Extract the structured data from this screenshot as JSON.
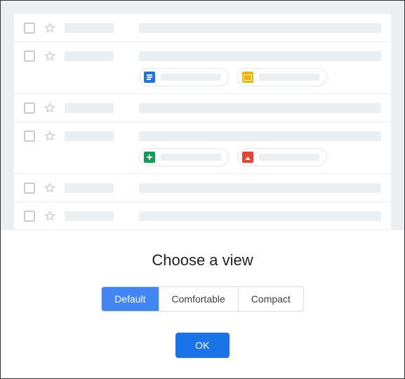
{
  "heading": "Choose a view",
  "options": {
    "default": "Default",
    "comfortable": "Comfortable",
    "compact": "Compact"
  },
  "selected_option": "default",
  "ok_label": "OK",
  "rows": [
    {
      "attachments": []
    },
    {
      "attachments": [
        {
          "type": "doc"
        },
        {
          "type": "slides"
        }
      ]
    },
    {
      "attachments": []
    },
    {
      "attachments": [
        {
          "type": "sheets"
        },
        {
          "type": "photo"
        }
      ]
    },
    {
      "attachments": []
    },
    {
      "attachments": []
    }
  ]
}
